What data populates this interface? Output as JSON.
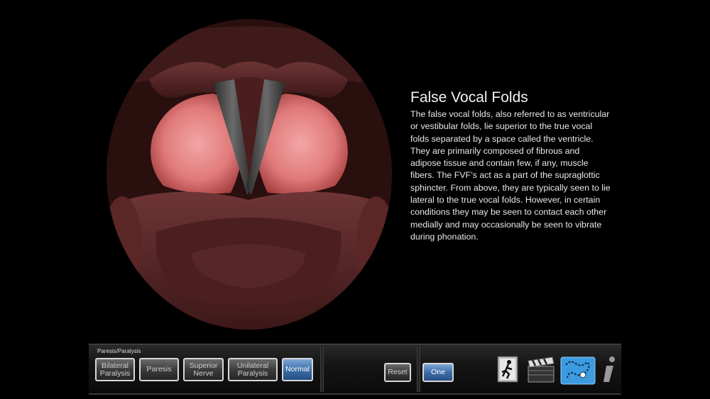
{
  "info": {
    "title": "False Vocal Folds",
    "body": "The false vocal folds, also referred to as ventricular or vestibular folds, lie superior to the true vocal folds separated by a space called the ventricle.  They are primarily composed of fibrous and adipose tissue and contain  few, if any, muscle fibers.  The FVF’s act as a part of the supraglottic sphincter.  From above, they are typically seen to lie lateral to the true vocal folds.  However, in certain  conditions they may be seen to contact each other medially and may occasionally be seen to vibrate during phonation."
  },
  "toolbar": {
    "group_label": "Paresis/Paralysis",
    "buttons": [
      {
        "line1": "Bilateral",
        "line2": "Paralysis"
      },
      {
        "line1": "Paresis",
        "line2": ""
      },
      {
        "line1": "Superior",
        "line2": "Nerve"
      },
      {
        "line1": "Unilateral",
        "line2": "Paralysis"
      },
      {
        "line1": "Normal",
        "line2": ""
      }
    ],
    "reset_label": "Reset",
    "one_label": "One",
    "icons": [
      "exit-runner-icon",
      "clapperboard-icon",
      "trace-path-icon",
      "info-icon"
    ],
    "accent_color": "#3d6ea8"
  }
}
